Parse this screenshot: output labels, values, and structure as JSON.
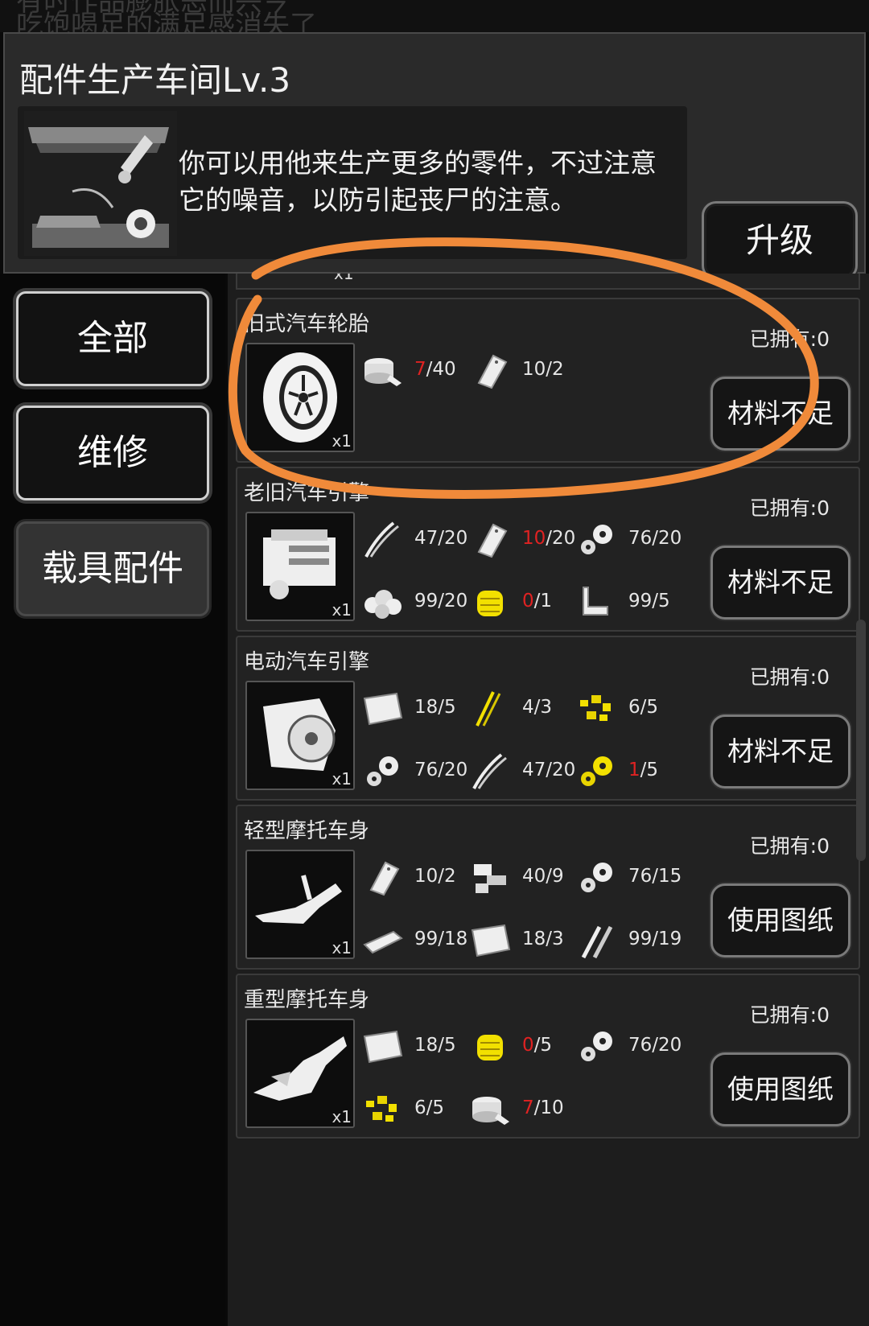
{
  "background_text": {
    "line1": "有时作品膨胀恶而兴今",
    "line2": "吃饱喝足的满足感消失了"
  },
  "header": {
    "title": "配件生产车间Lv.3",
    "description": "你可以用他来生产更多的零件，不过注意它的噪音，以防引起丧尸的注意。",
    "upgrade_label": "升级"
  },
  "sidebar": {
    "items": [
      {
        "label": "全部"
      },
      {
        "label": "维修"
      },
      {
        "label": "载具配件"
      }
    ]
  },
  "colors": {
    "accent_annotation": "#f08a3a",
    "insufficient": "#e02222",
    "material_yellow": "#f2e000"
  },
  "items": [
    {
      "name": "旧式汽车轮胎",
      "owned": "已拥有:0",
      "qty": "x1",
      "button": "材料不足",
      "icon": "tire-icon",
      "materials": [
        {
          "icon": "rubber-roll-icon",
          "have": "7",
          "need": "/40",
          "low": true
        },
        {
          "icon": "metal-plate-icon",
          "have": "10",
          "need": "/2",
          "low": false
        }
      ]
    },
    {
      "name": "老旧汽车引擎",
      "owned": "已拥有:0",
      "qty": "x1",
      "button": "材料不足",
      "icon": "engine-icon",
      "materials": [
        {
          "icon": "wire-icon",
          "have": "47",
          "need": "/20",
          "low": false
        },
        {
          "icon": "metal-plate-icon",
          "have": "10",
          "need": "/20",
          "low": true
        },
        {
          "icon": "gears-icon",
          "have": "76",
          "need": "/20",
          "low": false
        },
        {
          "icon": "cotton-icon",
          "have": "99",
          "need": "/20",
          "low": false
        },
        {
          "icon": "yellow-spring-icon",
          "have": "0",
          "need": "/1",
          "low": true
        },
        {
          "icon": "pipe-icon",
          "have": "99",
          "need": "/5",
          "low": false
        }
      ]
    },
    {
      "name": "电动汽车引擎",
      "owned": "已拥有:0",
      "qty": "x1",
      "button": "材料不足",
      "icon": "electric-motor-icon",
      "materials": [
        {
          "icon": "sheet-metal-icon",
          "have": "18",
          "need": "/5",
          "low": false
        },
        {
          "icon": "yellow-wire-icon",
          "have": "4",
          "need": "/3",
          "low": false
        },
        {
          "icon": "yellow-scrap-icon",
          "have": "6",
          "need": "/5",
          "low": false
        },
        {
          "icon": "gears-icon",
          "have": "76",
          "need": "/20",
          "low": false
        },
        {
          "icon": "wire-icon",
          "have": "47",
          "need": "/20",
          "low": false
        },
        {
          "icon": "yellow-gears-icon",
          "have": "1",
          "need": "/5",
          "low": true
        }
      ]
    },
    {
      "name": "轻型摩托车身",
      "owned": "已拥有:0",
      "qty": "x1",
      "button": "使用图纸",
      "icon": "light-motorcycle-frame-icon",
      "materials": [
        {
          "icon": "metal-plate-icon",
          "have": "10",
          "need": "/2",
          "low": false
        },
        {
          "icon": "machine-parts-icon",
          "have": "40",
          "need": "/9",
          "low": false
        },
        {
          "icon": "gears-icon",
          "have": "76",
          "need": "/15",
          "low": false
        },
        {
          "icon": "metal-bar-icon",
          "have": "99",
          "need": "/18",
          "low": false
        },
        {
          "icon": "sheet-metal-icon",
          "have": "18",
          "need": "/3",
          "low": false
        },
        {
          "icon": "screws-icon",
          "have": "99",
          "need": "/19",
          "low": false
        }
      ]
    },
    {
      "name": "重型摩托车身",
      "owned": "已拥有:0",
      "qty": "x1",
      "button": "使用图纸",
      "icon": "heavy-motorcycle-frame-icon",
      "materials": [
        {
          "icon": "sheet-metal-icon",
          "have": "18",
          "need": "/5",
          "low": false
        },
        {
          "icon": "yellow-spring-icon",
          "have": "0",
          "need": "/5",
          "low": true
        },
        {
          "icon": "gears-icon",
          "have": "76",
          "need": "/20",
          "low": false
        },
        {
          "icon": "yellow-scrap-icon",
          "have": "6",
          "need": "/5",
          "low": false
        },
        {
          "icon": "rubber-roll-icon",
          "have": "7",
          "need": "/10",
          "low": true
        }
      ]
    }
  ],
  "partial_top_card": {
    "qty": "x1"
  }
}
